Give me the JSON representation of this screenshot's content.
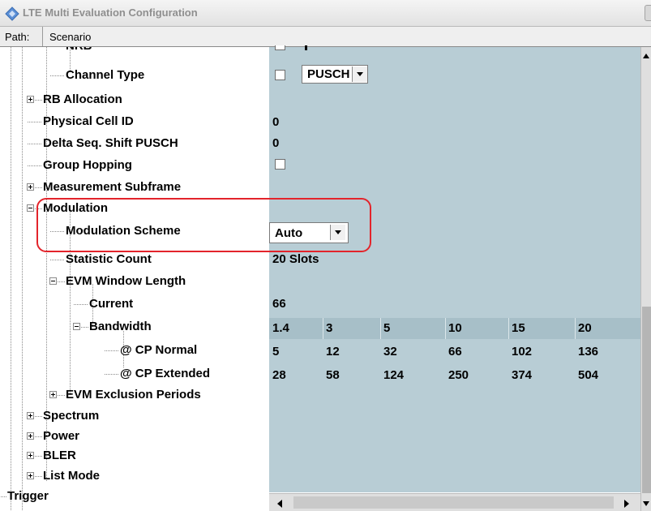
{
  "window": {
    "title": "LTE Multi Evaluation Configuration",
    "icon": "lte-config-icon"
  },
  "path": {
    "label": "Path:",
    "value": "Scenario"
  },
  "tree": {
    "rows": [
      {
        "label": "NRB",
        "indent": 3
      },
      {
        "label": "Channel Type",
        "indent": 3
      },
      {
        "label": "RB Allocation",
        "indent": 2
      },
      {
        "label": "Physical Cell ID",
        "indent": 2
      },
      {
        "label": "Delta Seq. Shift PUSCH",
        "indent": 2
      },
      {
        "label": "Group Hopping",
        "indent": 2
      },
      {
        "label": "Measurement Subframe",
        "indent": 2
      },
      {
        "label": "Modulation",
        "indent": 2
      },
      {
        "label": "Modulation Scheme",
        "indent": 3
      },
      {
        "label": "Statistic Count",
        "indent": 3
      },
      {
        "label": "EVM Window Length",
        "indent": 3
      },
      {
        "label": "Current",
        "indent": 4
      },
      {
        "label": "Bandwidth",
        "indent": 4
      },
      {
        "label": "@ CP Normal",
        "indent": 5
      },
      {
        "label": "@ CP Extended",
        "indent": 5
      },
      {
        "label": "EVM Exclusion Periods",
        "indent": 3
      },
      {
        "label": "Spectrum",
        "indent": 2
      },
      {
        "label": "Power",
        "indent": 2
      },
      {
        "label": "BLER",
        "indent": 2
      },
      {
        "label": "List Mode",
        "indent": 2
      },
      {
        "label": "Trigger",
        "indent": 1
      }
    ]
  },
  "values": {
    "channel_type": "PUSCH",
    "physical_cell_id": "0",
    "delta_seq_shift": "0",
    "modulation_scheme": "Auto",
    "statistic_count": "20 Slots",
    "evm_current": "66",
    "bandwidth_headers": [
      "1.4",
      "3",
      "5",
      "10",
      "15",
      "20"
    ],
    "cp_normal": [
      "5",
      "12",
      "32",
      "66",
      "102",
      "136"
    ],
    "cp_extended": [
      "28",
      "58",
      "124",
      "250",
      "374",
      "504"
    ]
  },
  "colors": {
    "value_pane": "#b8cdd5",
    "highlight": "#e3242b"
  }
}
